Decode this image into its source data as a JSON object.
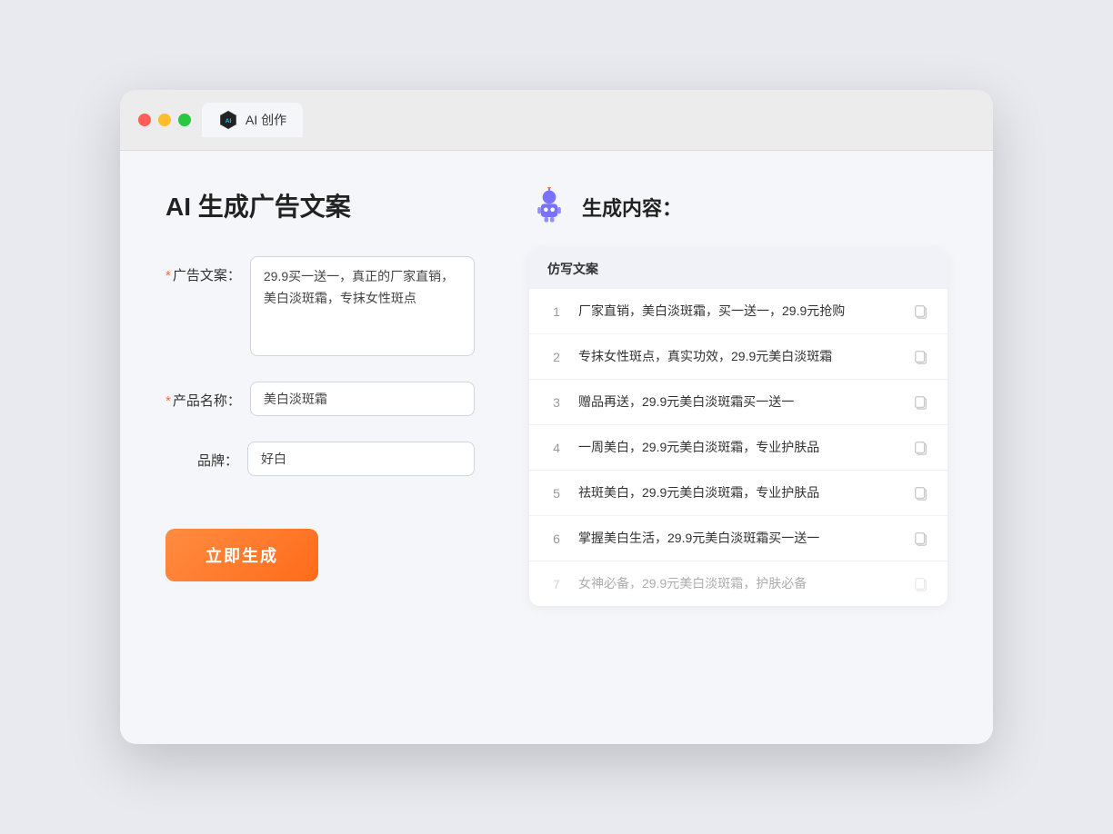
{
  "window": {
    "tab_label": "AI 创作"
  },
  "left": {
    "title": "AI 生成广告文案",
    "fields": [
      {
        "id": "ad_copy",
        "label": "广告文案：",
        "required": true,
        "type": "textarea",
        "value": "29.9买一送一，真正的厂家直销，美白淡斑霜，专抹女性斑点",
        "placeholder": ""
      },
      {
        "id": "product_name",
        "label": "产品名称：",
        "required": true,
        "type": "input",
        "value": "美白淡斑霜",
        "placeholder": ""
      },
      {
        "id": "brand",
        "label": "品牌：",
        "required": false,
        "type": "input",
        "value": "好白",
        "placeholder": ""
      }
    ],
    "generate_button": "立即生成"
  },
  "right": {
    "title": "生成内容：",
    "table_header": "仿写文案",
    "results": [
      {
        "num": "1",
        "text": "厂家直销，美白淡斑霜，买一送一，29.9元抢购",
        "faded": false
      },
      {
        "num": "2",
        "text": "专抹女性斑点，真实功效，29.9元美白淡斑霜",
        "faded": false
      },
      {
        "num": "3",
        "text": "赠品再送，29.9元美白淡斑霜买一送一",
        "faded": false
      },
      {
        "num": "4",
        "text": "一周美白，29.9元美白淡斑霜，专业护肤品",
        "faded": false
      },
      {
        "num": "5",
        "text": "祛斑美白，29.9元美白淡斑霜，专业护肤品",
        "faded": false
      },
      {
        "num": "6",
        "text": "掌握美白生活，29.9元美白淡斑霜买一送一",
        "faded": false
      },
      {
        "num": "7",
        "text": "女神必备，29.9元美白淡斑霜，护肤必备",
        "faded": true
      }
    ]
  }
}
